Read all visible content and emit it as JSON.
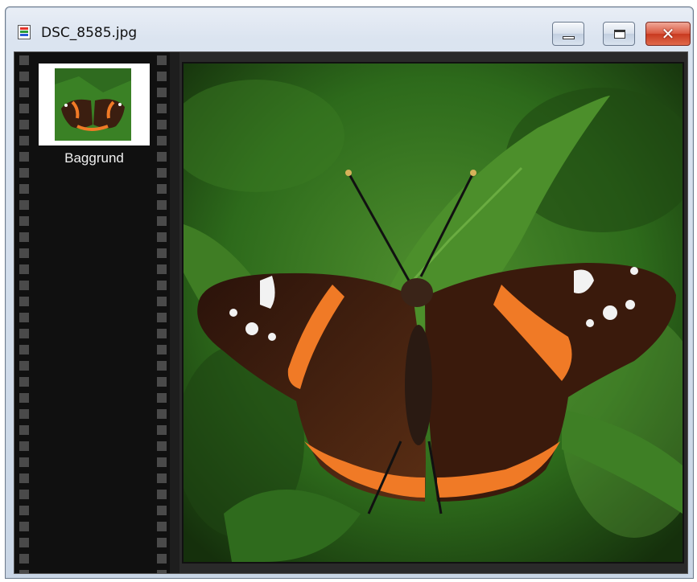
{
  "window": {
    "title": "DSC_8585.jpg",
    "icon": "image-file-icon",
    "controls": {
      "minimize": "minimize-icon",
      "maximize": "maximize-icon",
      "close": "close-icon",
      "close_glyph": "✕"
    }
  },
  "filmstrip": {
    "items": [
      {
        "label": "Baggrund",
        "selected": true
      }
    ]
  },
  "viewer": {
    "subject": "photo"
  },
  "colors": {
    "close_button": "#d9583f",
    "filmstrip": "#101010",
    "title_bar": "#dbe4f0"
  }
}
